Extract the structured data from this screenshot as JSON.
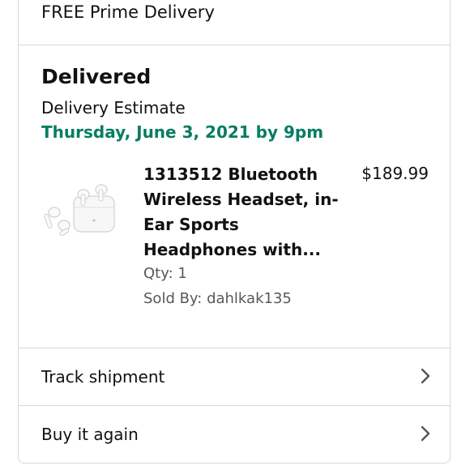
{
  "top": {
    "free_delivery": "FREE Prime Delivery"
  },
  "shipment": {
    "status": "Delivered",
    "estimate_label": "Delivery Estimate",
    "estimate_date": "Thursday, June 3, 2021 by 9pm"
  },
  "item": {
    "title": "1313512 Bluetooth Wireless Headset, in-Ear Sports Headphones with...",
    "price": "$189.99",
    "qty": "Qty: 1",
    "sold_by": "Sold By: dahlkak135",
    "image_icon": "earbuds-product-image"
  },
  "actions": [
    {
      "label": "Track shipment",
      "icon": "chevron-right-icon"
    },
    {
      "label": "Buy it again",
      "icon": "chevron-right-icon"
    }
  ],
  "colors": {
    "delivery_green": "#067d62",
    "secondary_text": "#565959",
    "border": "#d5d9d9"
  }
}
